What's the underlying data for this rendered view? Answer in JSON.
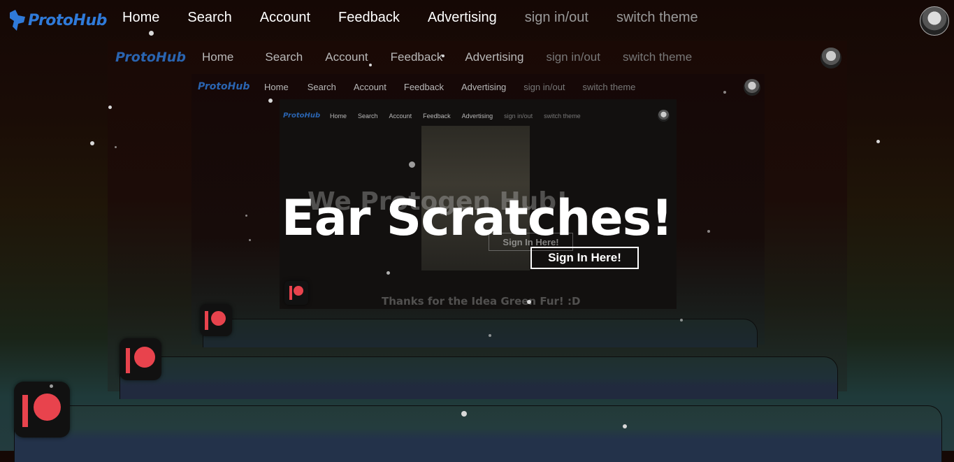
{
  "brand": {
    "logo_text": "ProtoHub"
  },
  "nav": {
    "links": [
      "Home",
      "Search",
      "Account",
      "Feedback",
      "Advertising"
    ],
    "secondary": [
      "sign in/out",
      "switch theme"
    ]
  },
  "hero": {
    "title": "Ear Scratches!",
    "button": "Sign In Here!"
  },
  "nested": {
    "ghost_title": "We Protogen Hub!",
    "ghost_button": "Sign In Here!",
    "ghost_thanks": "Thanks for the Idea Green Fur! :D",
    "browser_tab": "ProtoHub"
  },
  "colors": {
    "brand_blue": "#2f7ad9",
    "patreon_red": "#e8434d"
  }
}
